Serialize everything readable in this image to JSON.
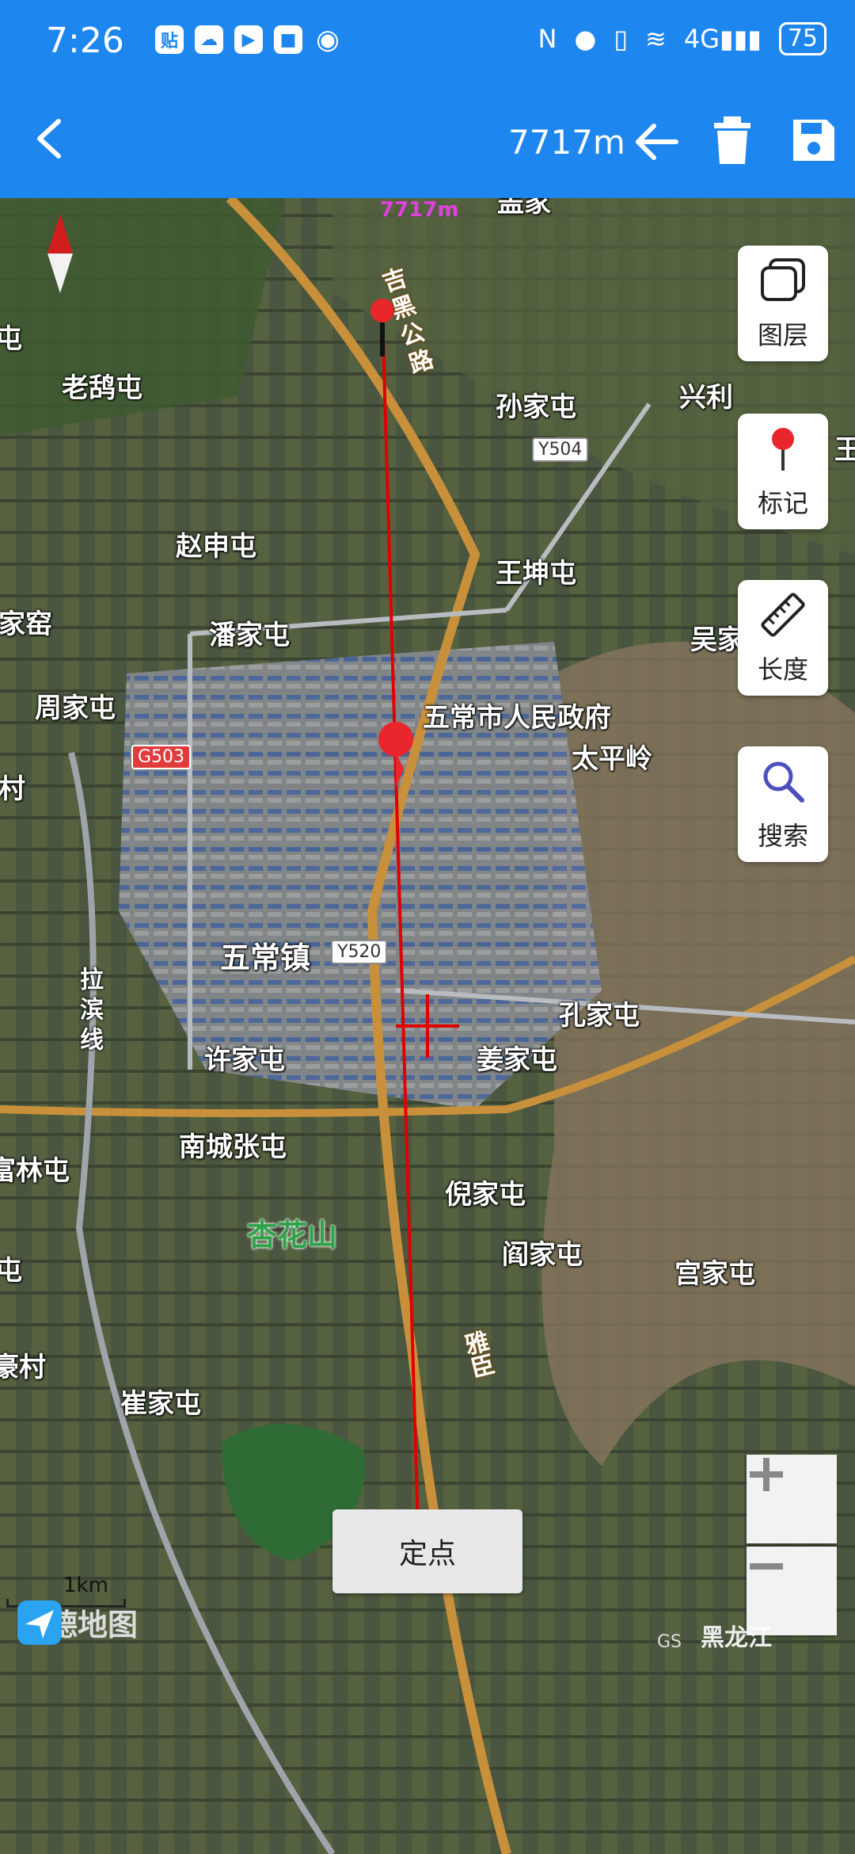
{
  "status_bar": {
    "time": "7:26",
    "battery": "75",
    "network": "4G"
  },
  "toolbar": {
    "distance": "7717m"
  },
  "map": {
    "places": [
      {
        "name": "孙家屯"
      },
      {
        "name": "兴利"
      },
      {
        "name": "老鸹屯"
      },
      {
        "name": "赵申屯"
      },
      {
        "name": "王坤屯"
      },
      {
        "name": "家窑"
      },
      {
        "name": "潘家屯"
      },
      {
        "name": "吴家"
      },
      {
        "name": "周家屯"
      },
      {
        "name": "五常市人民政府"
      },
      {
        "name": "太平岭"
      },
      {
        "name": "村"
      },
      {
        "name": "五常镇"
      },
      {
        "name": "孔家屯"
      },
      {
        "name": "许家屯"
      },
      {
        "name": "姜家屯"
      },
      {
        "name": "南城张屯"
      },
      {
        "name": "富林屯"
      },
      {
        "name": "倪家屯"
      },
      {
        "name": "杏花山"
      },
      {
        "name": "阎家屯"
      },
      {
        "name": "宫家屯"
      },
      {
        "name": "屯"
      },
      {
        "name": "豪村"
      },
      {
        "name": "崔家屯"
      },
      {
        "name": "盖家"
      },
      {
        "name": "王"
      }
    ],
    "road_names": {
      "north": "吉黑公路",
      "south": "雅臣",
      "rail": "拉滨线"
    },
    "shields": {
      "y504": "Y504",
      "g503": "G503",
      "y520": "Y520"
    },
    "measure_label": "7717m",
    "scale_label": "1km",
    "logo_text": "高德地图",
    "copyright": "GS",
    "watermark": "黑龙江"
  },
  "side_buttons": {
    "layers": "图层",
    "mark": "标记",
    "length": "长度",
    "search": "搜索"
  },
  "locate_button": "定点",
  "colors": {
    "accent": "#1e86ef",
    "measure_line": "#e00000",
    "marker": "#e8262b"
  }
}
